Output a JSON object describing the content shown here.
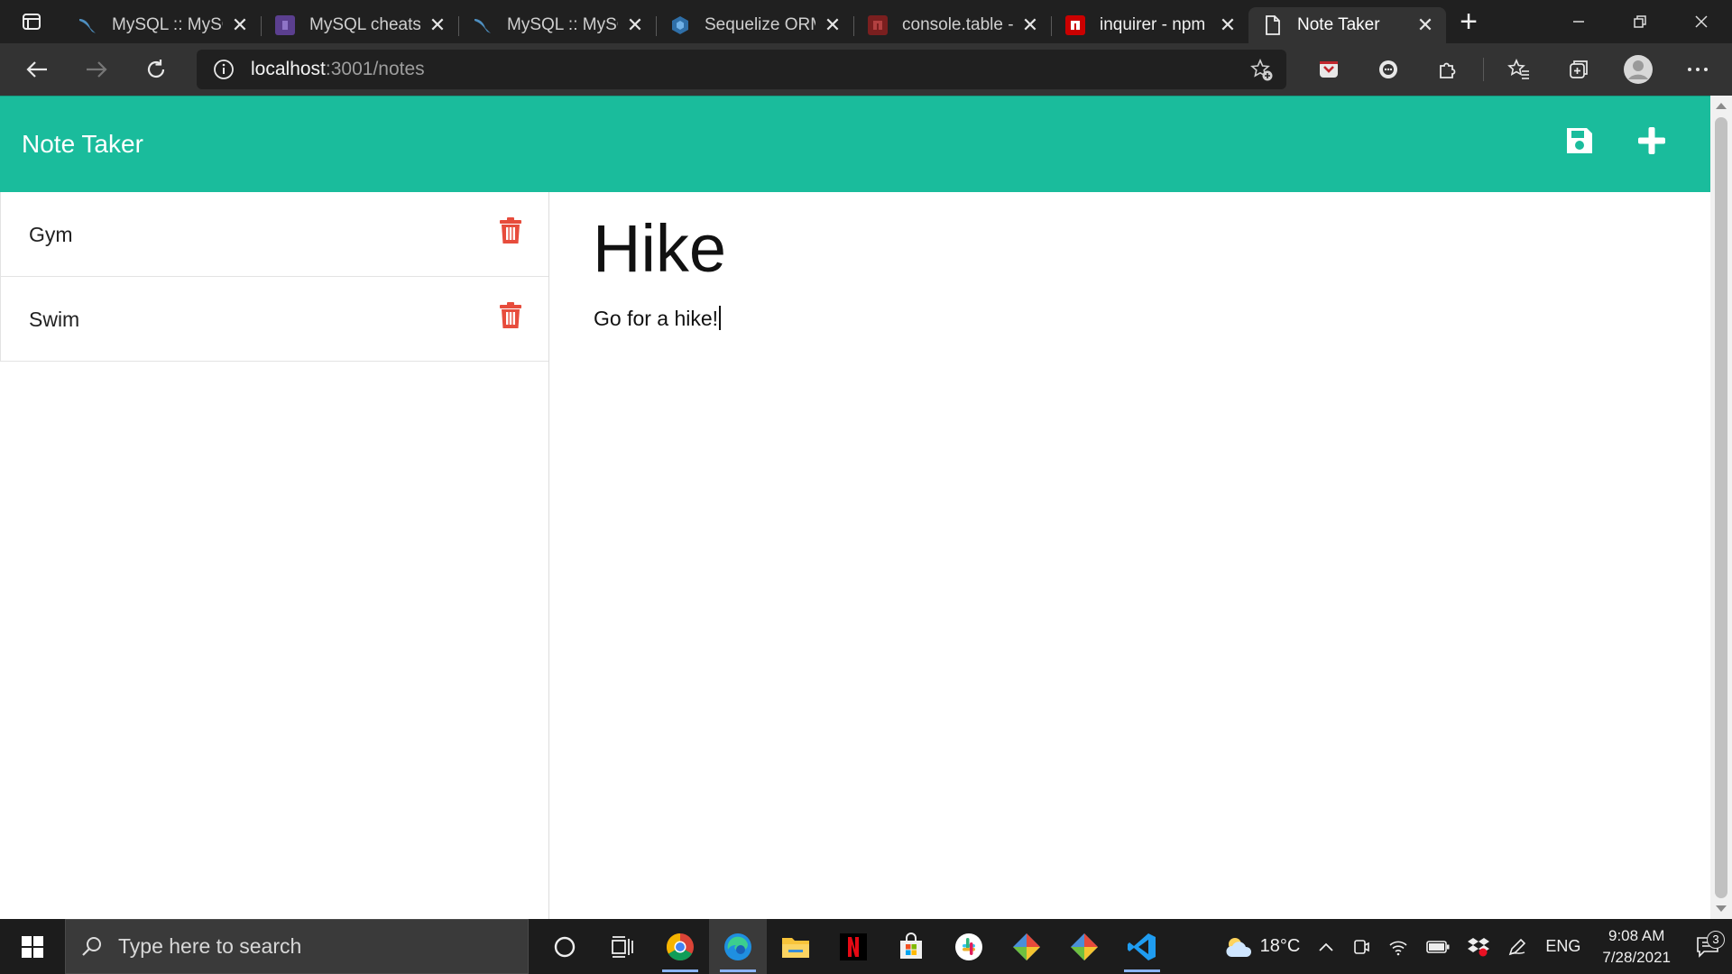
{
  "browser": {
    "tabs": [
      {
        "title": "MySQL :: MySQ",
        "favicon": "mysql-dolphin-icon",
        "active": false
      },
      {
        "title": "MySQL cheatsh",
        "favicon": "cheatsheet-icon",
        "active": false
      },
      {
        "title": "MySQL :: MySQ",
        "favicon": "mysql-dolphin-icon",
        "active": false
      },
      {
        "title": "Sequelize ORM",
        "favicon": "sequelize-icon",
        "active": false
      },
      {
        "title": "console.table -",
        "favicon": "npm-icon",
        "active": false
      },
      {
        "title": "inquirer - npm",
        "favicon": "npm-icon",
        "active": false
      },
      {
        "title": "Note Taker",
        "favicon": "page-icon",
        "active": true
      }
    ],
    "url_host": "localhost",
    "url_rest": ":3001/notes"
  },
  "app": {
    "brand": "Note Taker",
    "accent": "#1abc9c",
    "notes": [
      {
        "title": "Gym"
      },
      {
        "title": "Swim"
      }
    ],
    "active_note": {
      "title": "Hike",
      "text": "Go for a hike!"
    },
    "delete_color": "#e74c3c"
  },
  "taskbar": {
    "search_placeholder": "Type here to search",
    "weather": "18°C",
    "language": "ENG",
    "time": "9:08 AM",
    "date": "7/28/2021",
    "notifications": "3"
  }
}
